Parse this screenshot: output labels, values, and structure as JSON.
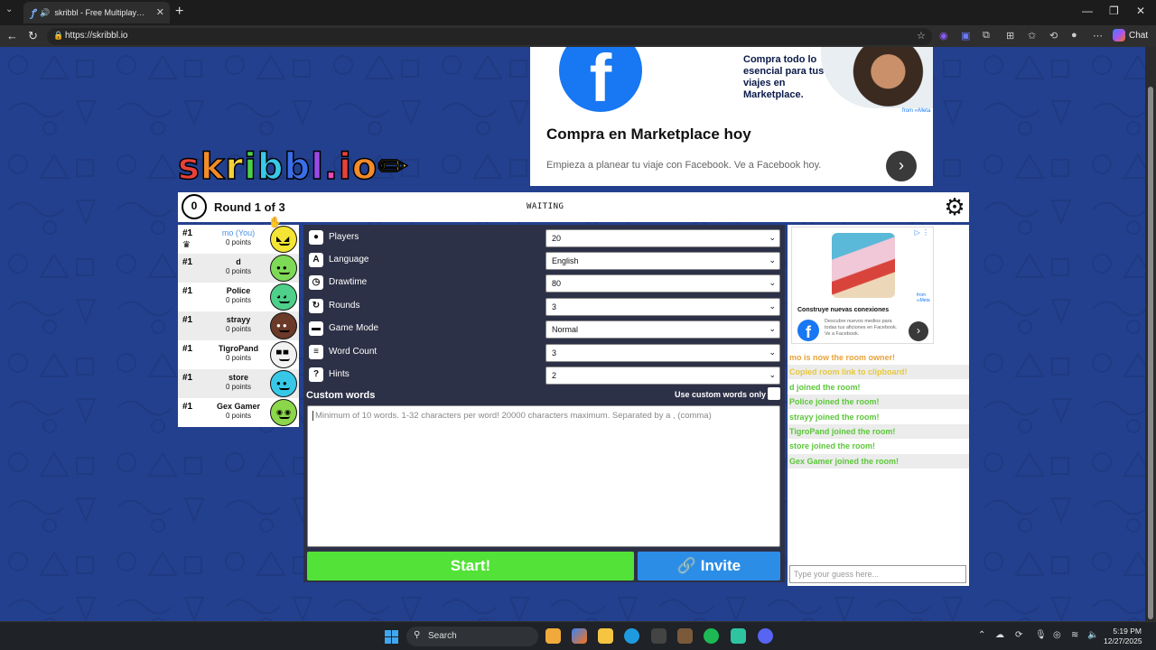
{
  "browser": {
    "tab_title": "skribbl - Free Multiplayer Drawing & Guessing Game",
    "url": "https://skribbl.io",
    "chat_label": "Chat"
  },
  "game": {
    "logo": "skribbl.io",
    "timer": "0",
    "round": "Round 1 of 3",
    "status": "WAITING"
  },
  "ad_top": {
    "promo": "Compra todo lo esencial para tus viajes en Marketplace.",
    "meta": "from ∞Meta",
    "headline": "Compra en Marketplace hoy",
    "sub": "Empieza a planear tu viaje con Facebook. Ve a Facebook hoy.",
    "fb": "f"
  },
  "players": [
    {
      "rank": "#1",
      "name": "mo (You)",
      "points": "0 points",
      "color": "#f4e534"
    },
    {
      "rank": "#1",
      "name": "d",
      "points": "0 points",
      "color": "#7ed957"
    },
    {
      "rank": "#1",
      "name": "Police",
      "points": "0 points",
      "color": "#4fd08a"
    },
    {
      "rank": "#1",
      "name": "strayy",
      "points": "0 points",
      "color": "#6b3a28"
    },
    {
      "rank": "#1",
      "name": "TigroPand",
      "points": "0 points",
      "color": "#f2f2f2"
    },
    {
      "rank": "#1",
      "name": "store",
      "points": "0 points",
      "color": "#37c8e8"
    },
    {
      "rank": "#1",
      "name": "Gex Gamer",
      "points": "0 points",
      "color": "#8bd64a"
    }
  ],
  "settings": [
    {
      "label": "Players",
      "value": "20",
      "icon": "person-icon"
    },
    {
      "label": "Language",
      "value": "English",
      "icon": "language-icon"
    },
    {
      "label": "Drawtime",
      "value": "80",
      "icon": "clock-icon"
    },
    {
      "label": "Rounds",
      "value": "3",
      "icon": "rounds-icon"
    },
    {
      "label": "Game Mode",
      "value": "Normal",
      "icon": "gamemode-icon"
    },
    {
      "label": "Word Count",
      "value": "3",
      "icon": "wordcount-icon"
    },
    {
      "label": "Hints",
      "value": "2",
      "icon": "hints-icon"
    }
  ],
  "custom": {
    "title": "Custom words",
    "only_label": "Use custom words only",
    "placeholder": "Minimum of 10 words. 1-32 characters per word! 20000 characters maximum. Separated by a , (comma)"
  },
  "buttons": {
    "start": "Start!",
    "invite": "Invite"
  },
  "ad_side": {
    "badge": "▷ ⋮",
    "meta": "from ∞Meta",
    "title": "Construye nuevas conexiones",
    "desc": "Descubre nuevos medios para todas tus aficiones en Facebook. Ve a Facebook.",
    "fb": "f"
  },
  "chat": {
    "messages": [
      {
        "text": "mo is now the room owner!",
        "color": "#e8a33a"
      },
      {
        "text": "Copied room link to clipboard!",
        "color": "#e8c83a"
      },
      {
        "text": "d joined the room!",
        "color": "#5cc73a"
      },
      {
        "text": "Police joined the room!",
        "color": "#5cc73a"
      },
      {
        "text": "strayy joined the room!",
        "color": "#5cc73a"
      },
      {
        "text": "TigroPand joined the room!",
        "color": "#5cc73a"
      },
      {
        "text": "store joined the room!",
        "color": "#5cc73a"
      },
      {
        "text": "Gex Gamer joined the room!",
        "color": "#5cc73a"
      }
    ],
    "guess_placeholder": "Type your guess here..."
  },
  "taskbar": {
    "search": "Search",
    "time": "5:19 PM",
    "date": "12/27/2025"
  }
}
